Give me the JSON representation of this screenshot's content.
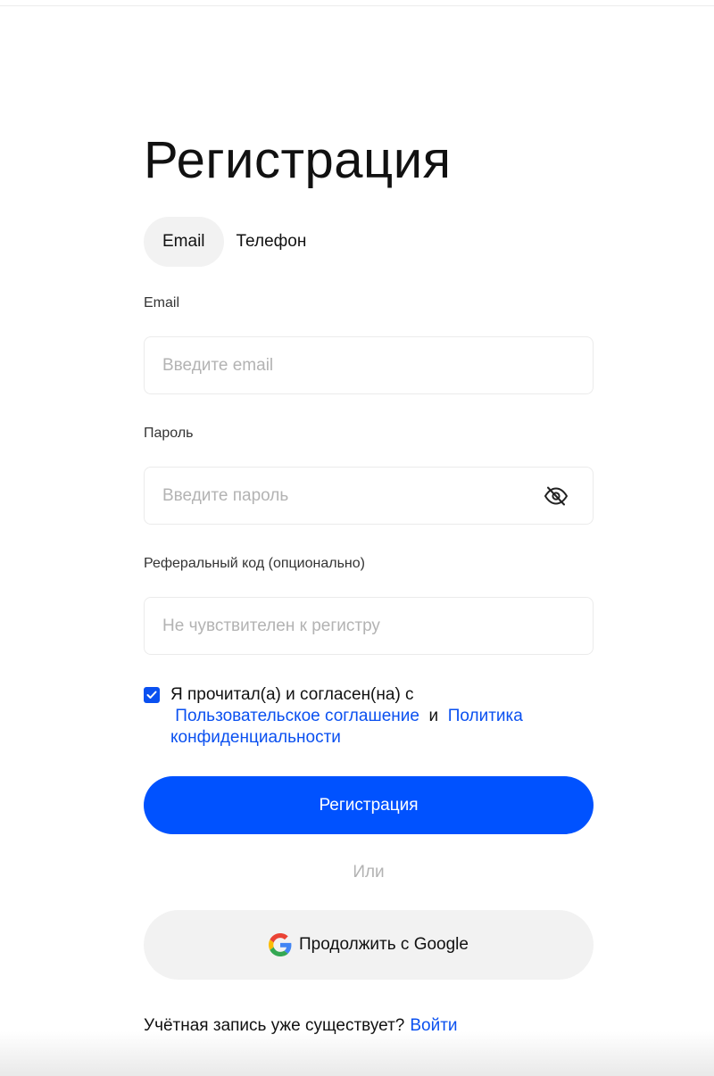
{
  "title": "Регистрация",
  "tabs": [
    {
      "label": "Email",
      "active": true
    },
    {
      "label": "Телефон",
      "active": false
    }
  ],
  "fields": {
    "email": {
      "label": "Email",
      "placeholder": "Введите email",
      "value": ""
    },
    "password": {
      "label": "Пароль",
      "placeholder": "Введите пароль",
      "value": "",
      "icon": "eye-off-icon"
    },
    "referral": {
      "label": "Реферальный код (опционально)",
      "placeholder": "Не чувствителен к регистру",
      "value": ""
    }
  },
  "agreement": {
    "checked": true,
    "prefix": "Я прочитал(а) и согласен(на) с",
    "terms_link": "Пользовательское соглашение",
    "conjunction": "и",
    "privacy_link": "Политика конфиденциальности"
  },
  "submit_label": "Регистрация",
  "divider_text": "Или",
  "google": {
    "label": "Продолжить с Google",
    "icon": "google-icon"
  },
  "login": {
    "prompt": "Учётная запись уже существует?",
    "link": "Войти"
  },
  "colors": {
    "accent": "#0052FF",
    "link": "#0A50F0",
    "tab_bg": "#F2F2F2",
    "placeholder": "#B3B3B3"
  }
}
